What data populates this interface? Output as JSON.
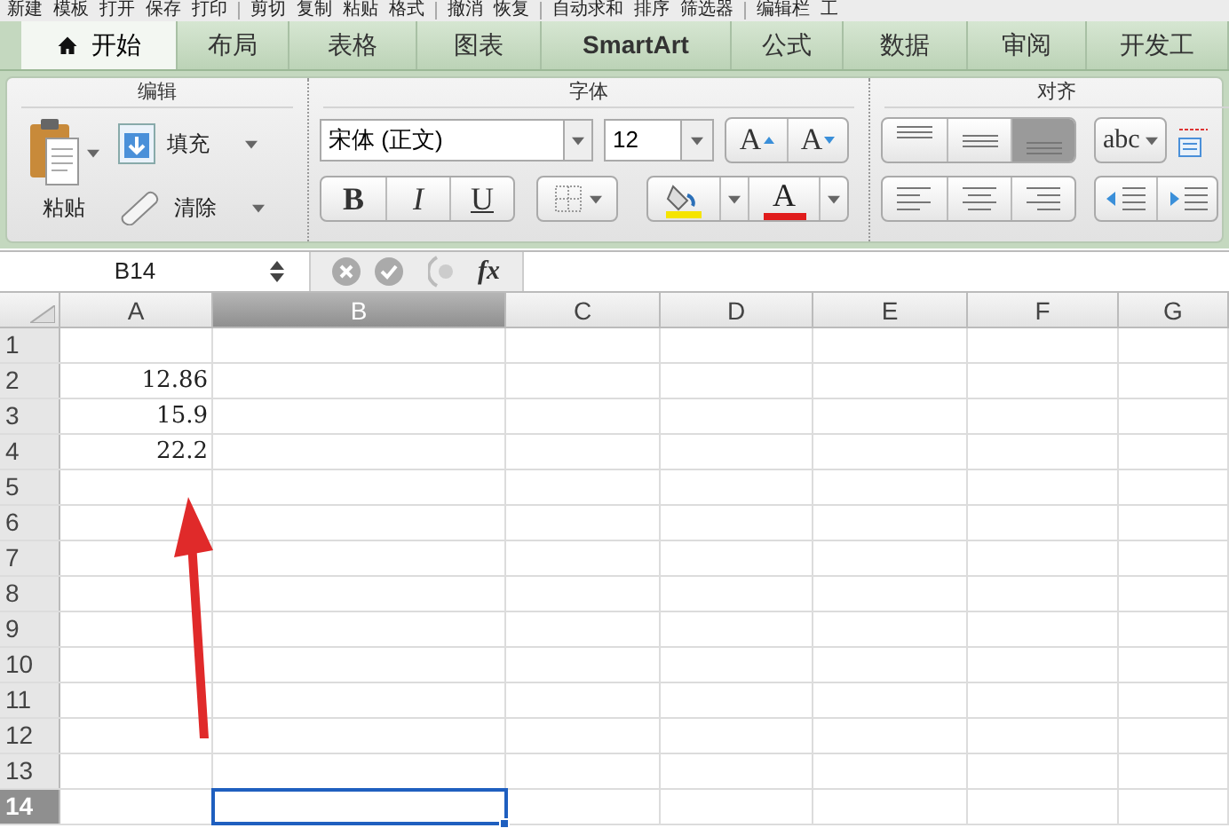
{
  "toolbar": {
    "groups": [
      [
        "新建",
        "模板",
        "打开",
        "保存",
        "打印"
      ],
      [
        "剪切",
        "复制",
        "粘贴",
        "格式"
      ],
      [
        "撤消",
        "恢复"
      ],
      [
        "自动求和",
        "排序",
        "筛选器"
      ],
      [
        "编辑栏",
        "工"
      ]
    ]
  },
  "tabs": [
    {
      "label": "开始",
      "selected": true
    },
    {
      "label": "布局",
      "selected": false
    },
    {
      "label": "表格",
      "selected": false
    },
    {
      "label": "图表",
      "selected": false
    },
    {
      "label": "SmartArt",
      "selected": false
    },
    {
      "label": "公式",
      "selected": false
    },
    {
      "label": "数据",
      "selected": false
    },
    {
      "label": "审阅",
      "selected": false
    },
    {
      "label": "开发工",
      "selected": false
    }
  ],
  "ribbon": {
    "edit": {
      "title": "编辑",
      "paste": "粘贴",
      "fill": "填充",
      "clear": "清除"
    },
    "font": {
      "title": "字体",
      "font_name": "宋体 (正文)",
      "font_size": "12",
      "bold": "B",
      "italic": "I",
      "underline": "U",
      "grow": "A",
      "shrink": "A",
      "font_color_letter": "A"
    },
    "align": {
      "title": "对齐",
      "vertical": [
        {
          "selected": false
        },
        {
          "selected": false
        },
        {
          "selected": true
        }
      ],
      "orientation": "abc"
    }
  },
  "formula_bar": {
    "name_box": "B14",
    "function_label": "fx"
  },
  "grid": {
    "columns": [
      {
        "label": "A",
        "selected": false
      },
      {
        "label": "B",
        "selected": true
      },
      {
        "label": "C",
        "selected": false
      },
      {
        "label": "D",
        "selected": false
      },
      {
        "label": "E",
        "selected": false
      },
      {
        "label": "F",
        "selected": false
      },
      {
        "label": "G",
        "selected": false
      }
    ],
    "rows": [
      {
        "label": "1",
        "selected": false
      },
      {
        "label": "2",
        "selected": false,
        "a": "12.86"
      },
      {
        "label": "3",
        "selected": false,
        "a": "15.9"
      },
      {
        "label": "4",
        "selected": false,
        "a": "22.2"
      },
      {
        "label": "5",
        "selected": false
      },
      {
        "label": "6",
        "selected": false
      },
      {
        "label": "7",
        "selected": false
      },
      {
        "label": "8",
        "selected": false
      },
      {
        "label": "9",
        "selected": false
      },
      {
        "label": "10",
        "selected": false
      },
      {
        "label": "11",
        "selected": false
      },
      {
        "label": "12",
        "selected": false
      },
      {
        "label": "13",
        "selected": false
      },
      {
        "label": "14",
        "selected": true
      }
    ]
  }
}
